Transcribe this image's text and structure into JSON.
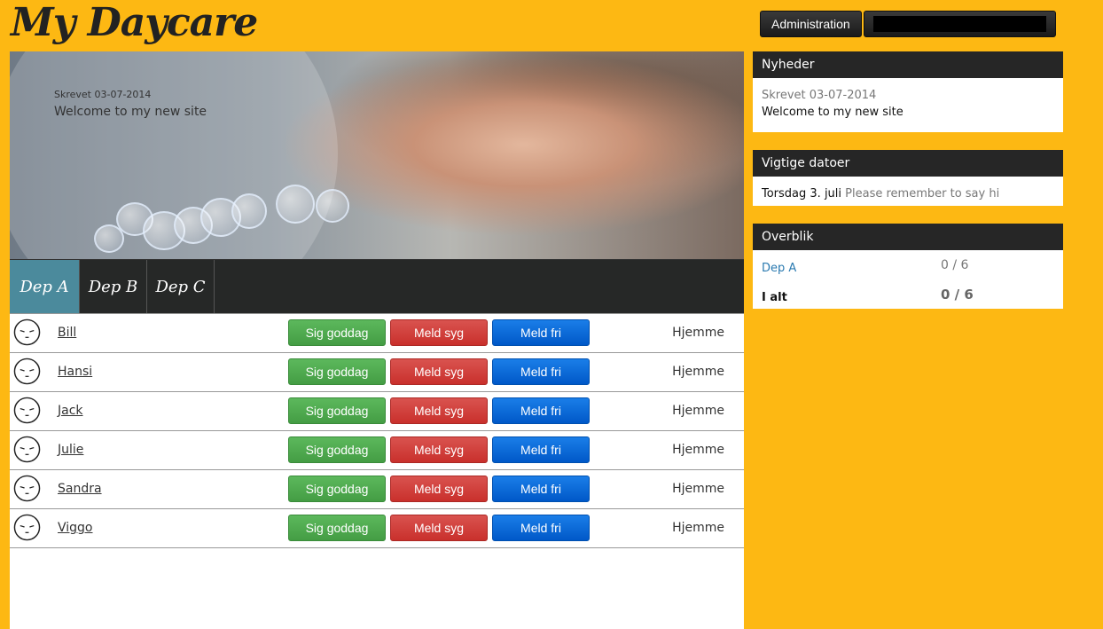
{
  "header": {
    "logo": "My Daycare",
    "admin_label": "Administration"
  },
  "hero": {
    "date": "Skrevet 03-07-2014",
    "title": "Welcome to my new site"
  },
  "tabs": [
    {
      "label": "Dep A",
      "active": true
    },
    {
      "label": "Dep B",
      "active": false
    },
    {
      "label": "Dep C",
      "active": false
    }
  ],
  "actions": {
    "hello": "Sig goddag",
    "sick": "Meld syg",
    "off": "Meld fri"
  },
  "children": [
    {
      "name": "Bill",
      "status": "Hjemme"
    },
    {
      "name": "Hansi",
      "status": "Hjemme"
    },
    {
      "name": "Jack",
      "status": "Hjemme"
    },
    {
      "name": "Julie",
      "status": "Hjemme"
    },
    {
      "name": "Sandra",
      "status": "Hjemme"
    },
    {
      "name": "Viggo",
      "status": "Hjemme"
    }
  ],
  "news": {
    "title": "Nyheder",
    "date": "Skrevet 03-07-2014",
    "text": "Welcome to my new site"
  },
  "dates": {
    "title": "Vigtige datoer",
    "date": "Torsdag 3. juli",
    "text": "Please remember to say hi"
  },
  "overview": {
    "title": "Overblik",
    "dep_label": "Dep A",
    "dep_value": "0 / 6",
    "total_label": "I alt",
    "total_value": "0 / 6"
  },
  "colors": {
    "background": "#FDB813",
    "tab_active": "#4b8a9c",
    "green": "#5cb85c",
    "red": "#d9534f",
    "blue": "#1a7ee8"
  },
  "icons": {
    "avatar": "sleeping-face-icon"
  }
}
